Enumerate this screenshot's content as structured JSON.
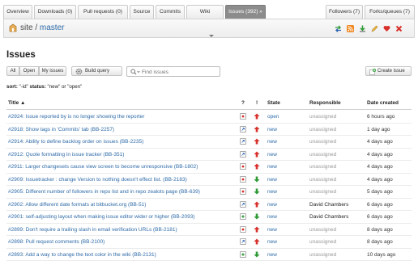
{
  "tabs": [
    {
      "label": "Overview"
    },
    {
      "label": "Downloads (0)"
    },
    {
      "label": "Pull requests (0)"
    },
    {
      "label": "Source"
    },
    {
      "label": "Commits"
    },
    {
      "label": "Wiki"
    },
    {
      "label": "Issues (392) »"
    },
    {
      "label": "Followers (7)"
    },
    {
      "label": "Forks/queues (7)"
    }
  ],
  "repo": {
    "owner": "site",
    "separator": " / ",
    "branch": "master",
    "tool_icons": [
      "compare-arrows-icon",
      "rss-icon",
      "download-icon",
      "edit-icon",
      "heart-icon",
      "delete-icon"
    ]
  },
  "page": {
    "title": "Issues"
  },
  "filters": {
    "all": "All",
    "open": "Open",
    "mine": "My issues",
    "build_query": "Build query",
    "search_placeholder": "Find issues",
    "create_issue": "Create issue"
  },
  "sort": {
    "prefix": "sort:",
    "value": "\"-id\"",
    "status_label": "status:",
    "status_value": "\"new\" or \"open\""
  },
  "columns": {
    "title": "Title ▲",
    "type": "?",
    "priority": "!",
    "state": "State",
    "responsible": "Responsible",
    "date": "Date created"
  },
  "colors": {
    "link": "#2f6ba8",
    "bug": "#d8312b",
    "enhancement": "#2a62b0",
    "proposal": "#2e9a36",
    "prio_up": "#d8312b",
    "prio_down": "#2e9a36"
  },
  "issues": [
    {
      "title": "#2924: Issue reported by is no longer showing the reporter",
      "type": "bug",
      "priority": "up",
      "state": "open",
      "responsible": "unassigned",
      "date": "6 hours ago"
    },
    {
      "title": "#2918: Show tags in 'Commits' tab (BB-2257)",
      "type": "enhancement",
      "priority": "up",
      "state": "new",
      "responsible": "unassigned",
      "date": "1 day ago"
    },
    {
      "title": "#2914: Ability to define backlog order on issues (BB-2235)",
      "type": "enhancement",
      "priority": "up",
      "state": "new",
      "responsible": "unassigned",
      "date": "4 days ago"
    },
    {
      "title": "#2912: Quote formatting in issue tracker (BB-351)",
      "type": "enhancement",
      "priority": "up",
      "state": "new",
      "responsible": "unassigned",
      "date": "4 days ago"
    },
    {
      "title": "#2911: Larger changesets cause view screen to become unresponsive (BB-1802)",
      "type": "bug",
      "priority": "up",
      "state": "new",
      "responsible": "unassigned",
      "date": "4 days ago"
    },
    {
      "title": "#2909: Issuetracker : change Version to nothing doesn't effect list. (BB-2183)",
      "type": "bug",
      "priority": "down",
      "state": "new",
      "responsible": "unassigned",
      "date": "4 days ago"
    },
    {
      "title": "#2905: Different number of followers in repo list and in repo zealots page (BB-639)",
      "type": "bug",
      "priority": "down",
      "state": "new",
      "responsible": "unassigned",
      "date": "5 days ago"
    },
    {
      "title": "#2902: Allow different date formats at bitbucket.org (BB-51)",
      "type": "enhancement",
      "priority": "up",
      "state": "new",
      "responsible": "David Chambers",
      "date": "6 days ago"
    },
    {
      "title": "#2901: self-adjusting layout when making issue editor wider or higher (BB-2093)",
      "type": "proposal",
      "priority": "down",
      "state": "new",
      "responsible": "David Chambers",
      "date": "6 days ago"
    },
    {
      "title": "#2899: Don't require a trailing slash in email verification URLs (BB-2181)",
      "type": "bug",
      "priority": "up",
      "state": "new",
      "responsible": "unassigned",
      "date": "8 days ago"
    },
    {
      "title": "#2898: Pull request comments (BB-2100)",
      "type": "enhancement",
      "priority": "up",
      "state": "new",
      "responsible": "unassigned",
      "date": "8 days ago"
    },
    {
      "title": "#2893: Add a way to change the text color in the wiki (BB-2131)",
      "type": "proposal",
      "priority": "down",
      "state": "new",
      "responsible": "unassigned",
      "date": "10 days ago"
    }
  ]
}
